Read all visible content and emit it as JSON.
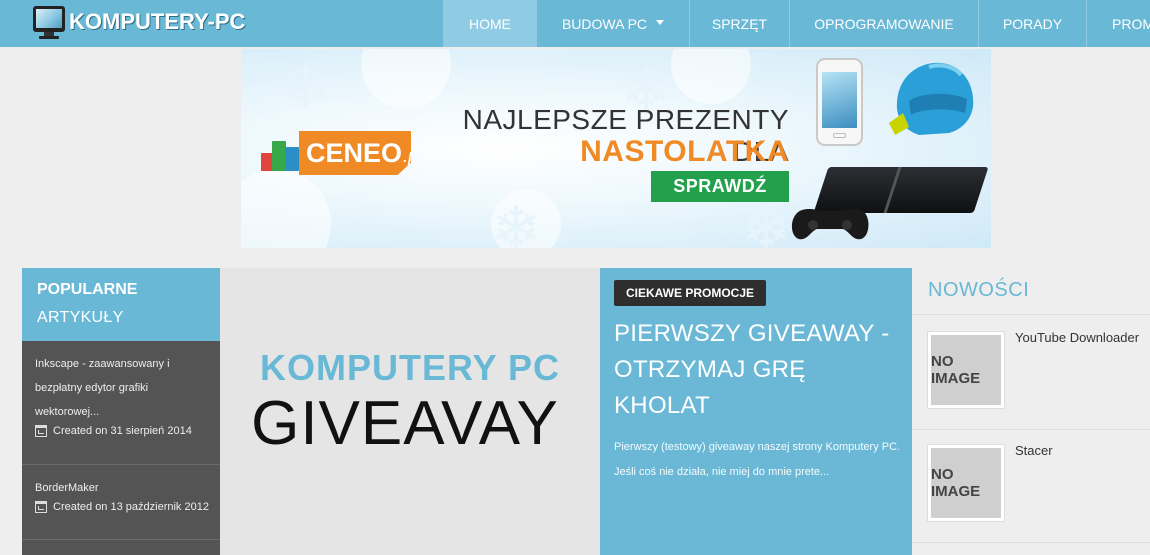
{
  "site": {
    "logo_text": "KOMPUTERY-PC"
  },
  "nav": {
    "items": [
      {
        "label": "HOME",
        "active": true
      },
      {
        "label": "BUDOWA PC",
        "dropdown": true
      },
      {
        "label": "SPRZĘT"
      },
      {
        "label": "OPROGRAMOWANIE"
      },
      {
        "label": "PORADY"
      },
      {
        "label": "PROM"
      }
    ]
  },
  "banner": {
    "brand": "CENEO",
    "brand_suffix": ".pl",
    "headline_line1": "NAJLEPSZE PREZENTY DLA",
    "headline_line2": "NASTOLATKA",
    "cta_label": "SPRAWDŹ",
    "colors": {
      "accent": "#f08a24",
      "cta": "#22a04b"
    }
  },
  "popular": {
    "title": "POPULARNE",
    "subtitle": "ARTYKUŁY",
    "articles": [
      {
        "title": "Inkscape - zaawansowany i bezpłatny edytor grafiki wektorowej...",
        "date": "Created on 31 sierpień 2014"
      },
      {
        "title": "BorderMaker",
        "date": "Created on 13 październik 2012"
      }
    ]
  },
  "giveaway_image": {
    "line1": "KOMPUTERY PC",
    "line2": "GIVEAVAY"
  },
  "feature": {
    "badge": "CIEKAWE PROMOCJE",
    "title": "PIERWSZY GIVEAWAY - OTRZYMAJ GRĘ KHOLAT",
    "excerpt": "Pierwszy (testowy) giveaway naszej strony Komputery PC. Jeśli coś nie działa, nie miej do mnie prete..."
  },
  "news": {
    "title": "NOWOŚCI",
    "items": [
      {
        "title": "YouTube Downloader",
        "thumb": "NO IMAGE"
      },
      {
        "title": "Stacer",
        "thumb": "NO IMAGE"
      }
    ]
  },
  "colors": {
    "brand_blue": "#68b8d6",
    "dark_sidebar": "#545454",
    "badge_dark": "#2e2e2e"
  }
}
